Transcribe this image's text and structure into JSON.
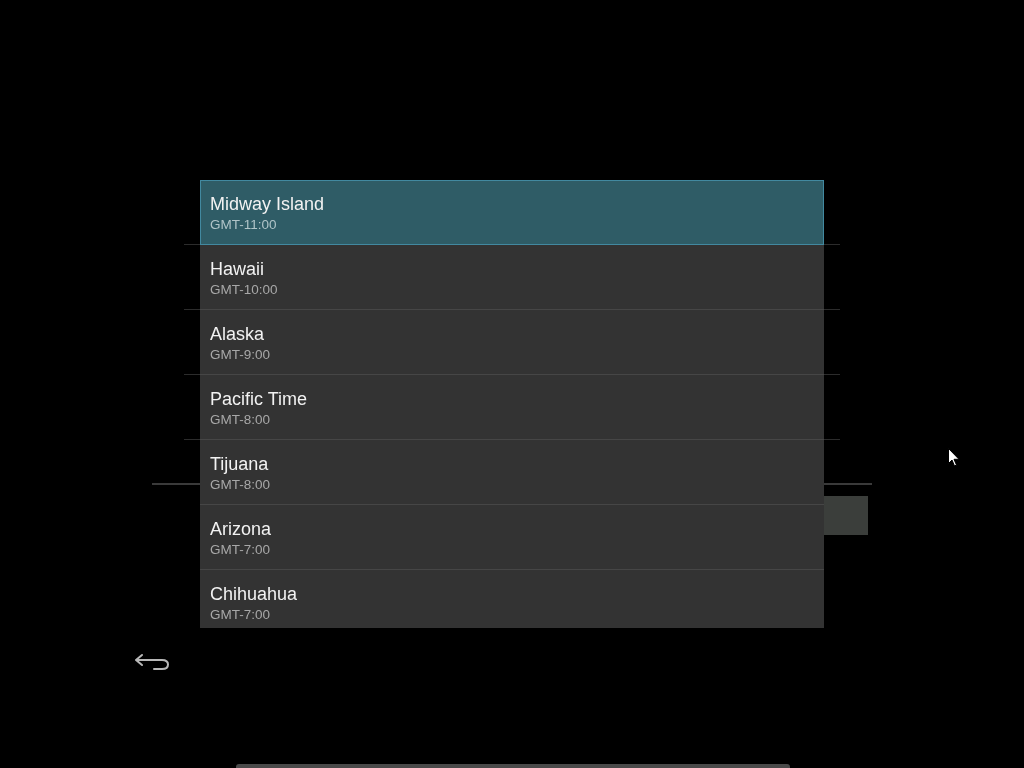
{
  "timezones": [
    {
      "name": "Midway Island",
      "offset": "GMT-11:00",
      "selected": true
    },
    {
      "name": "Hawaii",
      "offset": "GMT-10:00",
      "selected": false
    },
    {
      "name": "Alaska",
      "offset": "GMT-9:00",
      "selected": false
    },
    {
      "name": "Pacific Time",
      "offset": "GMT-8:00",
      "selected": false
    },
    {
      "name": "Tijuana",
      "offset": "GMT-8:00",
      "selected": false
    },
    {
      "name": "Arizona",
      "offset": "GMT-7:00",
      "selected": false
    },
    {
      "name": "Chihuahua",
      "offset": "GMT-7:00",
      "selected": false
    }
  ]
}
